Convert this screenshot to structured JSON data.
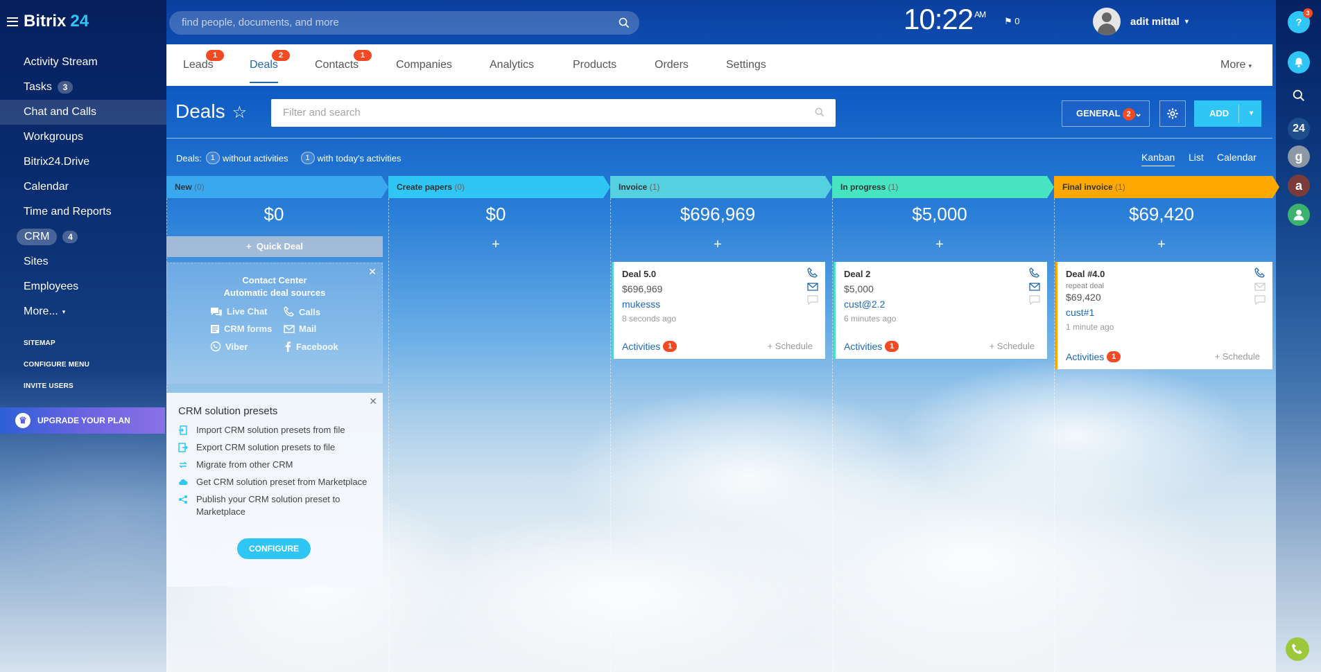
{
  "app": {
    "name": "Bitrix",
    "name_num": "24"
  },
  "search": {
    "placeholder": "find people, documents, and more"
  },
  "clock": {
    "time": "10:22",
    "ampm": "AM",
    "flags": "0"
  },
  "user": {
    "name": "adit mittal"
  },
  "sidebar": {
    "items": [
      {
        "label": "Activity Stream",
        "count": ""
      },
      {
        "label": "Tasks",
        "count": "3"
      },
      {
        "label": "Chat and Calls",
        "count": ""
      },
      {
        "label": "Workgroups",
        "count": ""
      },
      {
        "label": "Bitrix24.Drive",
        "count": ""
      },
      {
        "label": "Calendar",
        "count": ""
      },
      {
        "label": "Time and Reports",
        "count": ""
      },
      {
        "label": "CRM",
        "count": "4"
      },
      {
        "label": "Sites",
        "count": ""
      },
      {
        "label": "Employees",
        "count": ""
      },
      {
        "label": "More...",
        "count": ""
      }
    ],
    "links": [
      "SITEMAP",
      "CONFIGURE MENU",
      "INVITE USERS"
    ],
    "upgrade": "UPGRADE YOUR PLAN"
  },
  "right_bar": {
    "help_badge": "3",
    "counter": "24",
    "g": "g",
    "a": "a"
  },
  "tabs": [
    {
      "label": "Leads",
      "badge": "1"
    },
    {
      "label": "Deals",
      "badge": "2"
    },
    {
      "label": "Contacts",
      "badge": "1"
    },
    {
      "label": "Companies",
      "badge": ""
    },
    {
      "label": "Analytics",
      "badge": ""
    },
    {
      "label": "Products",
      "badge": ""
    },
    {
      "label": "Orders",
      "badge": ""
    },
    {
      "label": "Settings",
      "badge": ""
    }
  ],
  "tabs_more": "More",
  "page": {
    "title": "Deals",
    "filter_placeholder": "Filter and search"
  },
  "toolbar": {
    "general_label": "GENERAL",
    "general_badge": "2",
    "add_label": "ADD"
  },
  "info": {
    "prefix": "Deals:",
    "without_count": "1",
    "without_label": "without activities",
    "today_count": "1",
    "today_label": "with today's activities"
  },
  "views": [
    "Kanban",
    "List",
    "Calendar"
  ],
  "columns": [
    {
      "name": "New",
      "count": "(0)",
      "sum": "$0",
      "color": "#39a8ef"
    },
    {
      "name": "Create papers",
      "count": "(0)",
      "sum": "$0",
      "color": "#2fc6f6"
    },
    {
      "name": "Invoice",
      "count": "(1)",
      "sum": "$696,969",
      "color": "#55d0e0"
    },
    {
      "name": "In progress",
      "count": "(1)",
      "sum": "$5,000",
      "color": "#47e4c2"
    },
    {
      "name": "Final invoice",
      "count": "(1)",
      "sum": "$69,420",
      "color": "#ffa900"
    }
  ],
  "quick_deal": "Quick Deal",
  "contact_center": {
    "title1": "Contact Center",
    "title2": "Automatic deal sources",
    "sources": [
      "Live Chat",
      "Calls",
      "CRM forms",
      "Mail",
      "Viber",
      "Facebook"
    ]
  },
  "presets": {
    "title": "CRM solution presets",
    "items": [
      "Import CRM solution presets from file",
      "Export CRM solution presets to file",
      "Migrate from other CRM",
      "Get CRM solution preset from Marketplace",
      "Publish your CRM solution preset to Marketplace"
    ],
    "button": "CONFIGURE"
  },
  "cards": [
    {
      "title": "Deal 5.0",
      "subtitle": "",
      "amount": "$696,969",
      "contact": "mukesss",
      "time": "8 seconds ago",
      "activities": "Activities",
      "activities_count": "1",
      "schedule": "+ Schedule"
    },
    {
      "title": "Deal 2",
      "subtitle": "",
      "amount": "$5,000",
      "contact": "cust@2.2",
      "time": "6 minutes ago",
      "activities": "Activities",
      "activities_count": "1",
      "schedule": "+ Schedule"
    },
    {
      "title": "Deal #4.0",
      "subtitle": "repeat deal",
      "amount": "$69,420",
      "contact": "cust#1",
      "time": "1 minute ago",
      "activities": "Activities",
      "activities_count": "1",
      "schedule": "+ Schedule"
    }
  ]
}
